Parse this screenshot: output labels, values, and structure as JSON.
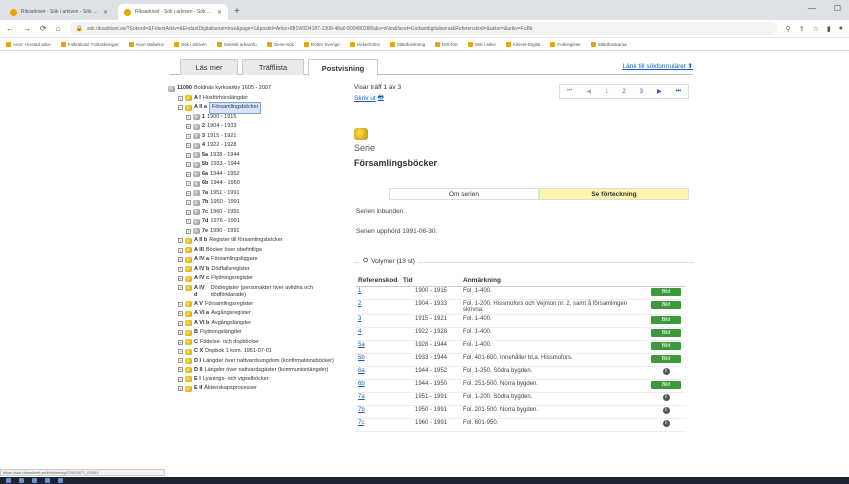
{
  "browser": {
    "tabs": [
      {
        "title": "Riksarkivet - Sök i arkiven - Sök arkiv"
      },
      {
        "title": "Riksarkivet - Sök i arkiven - Sök arkiv"
      }
    ],
    "new_tab": "+",
    "url": "sok.riksarkivet.se/?Sokord=&FritextArkiv=&EndastDigitaliserat=true&page=1&postid=Arkis+8819/0D4187-1308-48a0-800480286b&s=sNm&facet=Endastdigitaliserat&Referenskod=&aktor=&arkiv=FuBit",
    "bookmarks": [
      "Anor: Hisstad arkiv",
      "Folkräknat: Folkräkningar",
      "Anor-stallarkiv",
      "Sök i arkiven",
      "Svensk arkivinfo",
      "Gene-Sök",
      "Rötter Sverige",
      "Vickerförlist",
      "Släktforskning",
      "DIS-förr",
      "Sök i arkiv",
      "Arkivet-Digital",
      "Folkregister",
      "Släktforskarna"
    ]
  },
  "page_tabs": {
    "items": [
      "Läs mer",
      "Träfflista",
      "Postvisning"
    ],
    "active": "Postvisning",
    "link": "Länk till sökformuläret"
  },
  "tree": {
    "root": {
      "code": "11090",
      "label": "Boldnäs kyrkoarkiv 1605 - 2007"
    },
    "nodes": [
      {
        "code": "A I",
        "label": "Husförhörslängder",
        "level": 1,
        "sel": false
      },
      {
        "code": "A II a",
        "label": "Församlingsböcker",
        "level": 1,
        "sel": true
      },
      {
        "code": "1",
        "label": "1900 - 1915",
        "level": 2,
        "sel": false
      },
      {
        "code": "2",
        "label": "1904 - 1933",
        "level": 2,
        "sel": false
      },
      {
        "code": "3",
        "label": "1915 - 1921",
        "level": 2,
        "sel": false
      },
      {
        "code": "4",
        "label": "1922 - 1928",
        "level": 2,
        "sel": false
      },
      {
        "code": "5a",
        "label": "1928 - 1944",
        "level": 2,
        "sel": false
      },
      {
        "code": "5b",
        "label": "1933 - 1944",
        "level": 2,
        "sel": false
      },
      {
        "code": "6a",
        "label": "1944 - 1952",
        "level": 2,
        "sel": false
      },
      {
        "code": "6b",
        "label": "1944 - 1950",
        "level": 2,
        "sel": false
      },
      {
        "code": "7a",
        "label": "1951 - 1991",
        "level": 2,
        "sel": false
      },
      {
        "code": "7b",
        "label": "1950 - 1991",
        "level": 2,
        "sel": false
      },
      {
        "code": "7c",
        "label": "1960 - 1991",
        "level": 2,
        "sel": false
      },
      {
        "code": "7d",
        "label": "1976 - 1991",
        "level": 2,
        "sel": false
      },
      {
        "code": "7e",
        "label": "1990 - 1991",
        "level": 2,
        "sel": false
      },
      {
        "code": "A II b",
        "label": "Register till församlingsböcker",
        "level": 1,
        "sel": false
      },
      {
        "code": "A III",
        "label": "Böcker över obefintliga",
        "level": 1,
        "sel": false
      },
      {
        "code": "A IV a",
        "label": "Församlingsliggare",
        "level": 1,
        "sel": false
      },
      {
        "code": "A IV b",
        "label": "Dödfallsregister",
        "level": 1,
        "sel": false
      },
      {
        "code": "A IV c",
        "label": "Flyttningsregister",
        "level": 1,
        "sel": false
      },
      {
        "code": "A IV d",
        "label": "Dödregister (personakter över avlidna och dödförklarade)",
        "level": 1,
        "sel": false
      },
      {
        "code": "A V",
        "label": "Församlingsregister",
        "level": 1,
        "sel": false
      },
      {
        "code": "A VI a",
        "label": "Avgångsregister",
        "level": 1,
        "sel": false
      },
      {
        "code": "A VI b",
        "label": "Avgångslängder",
        "level": 1,
        "sel": false
      },
      {
        "code": "B",
        "label": "Flyttningslängder",
        "level": 1,
        "sel": false
      },
      {
        "code": "C",
        "label": "Födelse- och dopböcker",
        "level": 1,
        "sel": false
      },
      {
        "code": "C X",
        "label": "Dopbok 1 kom. 1951-07-01",
        "level": 1,
        "sel": false
      },
      {
        "code": "D I",
        "label": "Längder över nattvardsungdom (konfirmationsböcker)",
        "level": 1,
        "sel": false
      },
      {
        "code": "D II",
        "label": "Längder över nattvardsgäster (kommunionlängder)",
        "level": 1,
        "sel": false
      },
      {
        "code": "E I",
        "label": "Lysnings- och vigselböcker",
        "level": 1,
        "sel": false
      },
      {
        "code": "E II",
        "label": "Äktenskapsprocesser",
        "level": 1,
        "sel": false
      }
    ]
  },
  "main": {
    "hit_text": "Visar träff 1 av 3",
    "print_link": "Skriv ut",
    "pager": [
      "⏮",
      "◀",
      "1",
      "2",
      "3",
      "▶",
      "⏭"
    ],
    "serie_label": "Serie",
    "serie_title": "Församlingsböcker",
    "info_tabs": [
      "Om serien",
      "Se förteckning"
    ],
    "info_active": "Se förteckning",
    "info_line1": "Serien inbunden.",
    "info_line2": "Serien upphörd 1991-06-30.",
    "volumes_header": "Volymer (13 st)",
    "columns": [
      "Referenskod",
      "Tid",
      "Anmärkning",
      ""
    ],
    "rows": [
      {
        "ref": "1",
        "tid": "1900 - 1915",
        "note": "Fol. 1-400.",
        "action": "Bild"
      },
      {
        "ref": "2",
        "tid": "1904 - 1933",
        "note": "Fol. 1-200. Hissmofors och Vejmon nr. 2, samt å församlingen skrivna.",
        "action": "Bild"
      },
      {
        "ref": "3",
        "tid": "1915 - 1921",
        "note": "Fol. 1-400.",
        "action": "Bild"
      },
      {
        "ref": "4",
        "tid": "1922 - 1928",
        "note": "Fol. 1-400.",
        "action": "Bild"
      },
      {
        "ref": "5a",
        "tid": "1928 - 1944",
        "note": "Fol. 1-400.",
        "action": "Bild"
      },
      {
        "ref": "5b",
        "tid": "1933 - 1944",
        "note": "Fol. 401-600. Innehåller bl.a. Hissmofors.",
        "action": "Bild"
      },
      {
        "ref": "6a",
        "tid": "1944 - 1952",
        "note": "Fol. 1-250. Södra bygden.",
        "action": "info"
      },
      {
        "ref": "6b",
        "tid": "1944 - 1950",
        "note": "Fol. 251-500. Norra bygden.",
        "action": "Bild"
      },
      {
        "ref": "7a",
        "tid": "1951 - 1991",
        "note": "Fol. 1-200. Södra bygden.",
        "action": "info"
      },
      {
        "ref": "7b",
        "tid": "1950 - 1991",
        "note": "Fol. 201-500. Norra bygden.",
        "action": "info"
      },
      {
        "ref": "7c",
        "tid": "1960 - 1991",
        "note": "Fol. 601-950.",
        "action": "info"
      }
    ]
  },
  "status_url": "https://sok.riksarkivet.se/bildvisning/C0001871_00001",
  "colors": {
    "link": "#1a5fb4",
    "bild_button": "#3c9a3c",
    "active_tab": "#fff3b0"
  }
}
